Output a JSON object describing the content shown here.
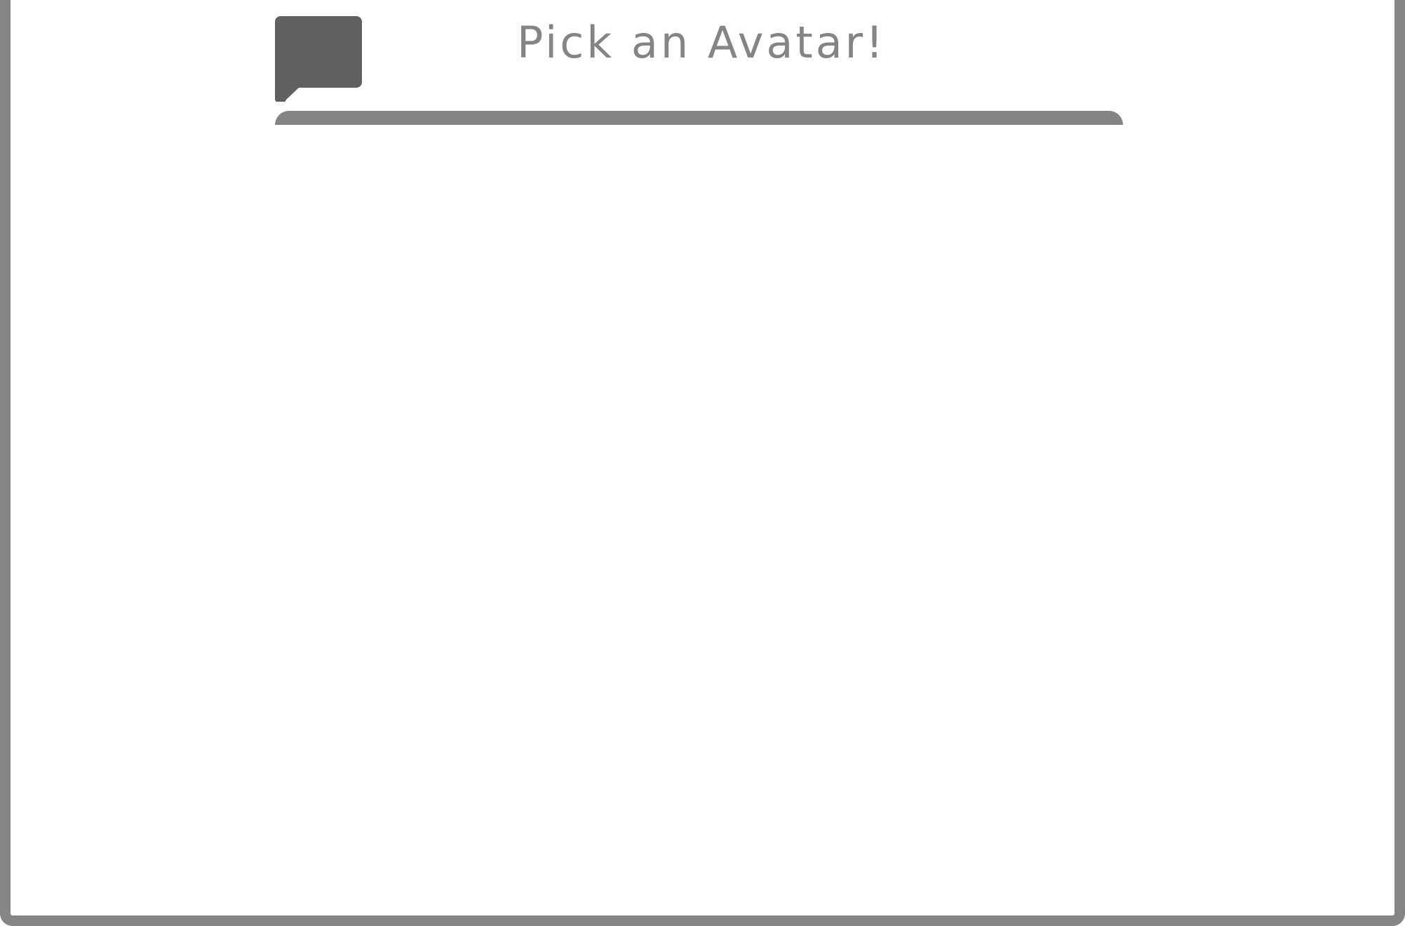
{
  "dialog": {
    "title": "Pick an Avatar!"
  },
  "icons": {
    "speech_bubble": "speech-bubble-icon"
  },
  "colors": {
    "frame_border": "#858585",
    "title_text": "#848484",
    "icon_fill": "#606060",
    "tab_bar": "#848484",
    "background": "#ffffff"
  }
}
